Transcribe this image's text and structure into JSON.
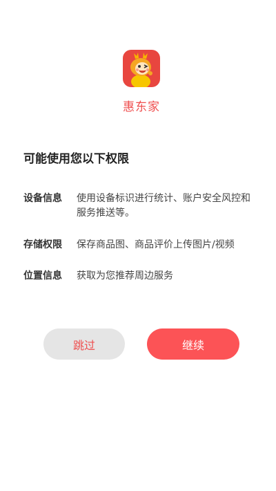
{
  "app": {
    "name": "惠东家",
    "logo_icon": "dragon-mascot-icon",
    "brand_color": "#ef4f4f"
  },
  "permissions": {
    "title": "可能使用您以下权限",
    "items": [
      {
        "label": "设备信息",
        "desc": "使用设备标识进行统计、账户安全风控和服务推送等。"
      },
      {
        "label": "存储权限",
        "desc": "保存商品图、商品评价上传图片/视频"
      },
      {
        "label": "位置信息",
        "desc": "获取为您推荐周边服务"
      }
    ]
  },
  "buttons": {
    "skip": "跳过",
    "continue": "继续",
    "skip_bg": "#e5e5e5",
    "continue_bg": "#fc5356"
  }
}
